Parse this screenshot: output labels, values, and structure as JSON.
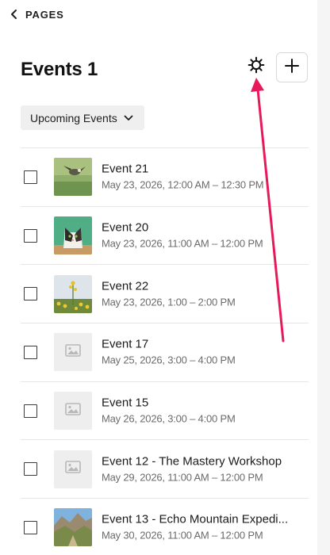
{
  "back": {
    "label": "PAGES",
    "icon": "chevron-left-icon"
  },
  "header": {
    "title": "Events 1",
    "settings_icon": "gear-icon",
    "add_icon": "plus-icon"
  },
  "filter": {
    "label": "Upcoming Events",
    "icon": "chevron-down-icon"
  },
  "events": [
    {
      "title": "Event 21",
      "date": "May 23, 2026, 12:00 AM – 12:30 PM",
      "thumbnail": "bird-in-grass"
    },
    {
      "title": "Event 20",
      "date": "May 23, 2026, 11:00 AM – 12:00 PM",
      "thumbnail": "cat-on-green"
    },
    {
      "title": "Event 22",
      "date": "May 23, 2026, 1:00 – 2:00 PM",
      "thumbnail": "wildflower-field"
    },
    {
      "title": "Event 17",
      "date": "May 25, 2026, 3:00 – 4:00 PM",
      "thumbnail": "image-placeholder-icon"
    },
    {
      "title": "Event 15",
      "date": "May 26, 2026, 3:00 – 4:00 PM",
      "thumbnail": "image-placeholder-icon"
    },
    {
      "title": "Event 12 - The Mastery Workshop",
      "date": "May 29, 2026, 11:00 AM – 12:00 PM",
      "thumbnail": "image-placeholder-icon"
    },
    {
      "title": "Event 13 - Echo Mountain Expedi...",
      "date": "May 30, 2026, 11:00 AM – 12:00 PM",
      "thumbnail": "mountain-valley"
    }
  ],
  "colors": {
    "annotation_arrow": "#e8195a",
    "placeholder_bg": "#eeeeee",
    "filter_bg": "#efefef"
  }
}
